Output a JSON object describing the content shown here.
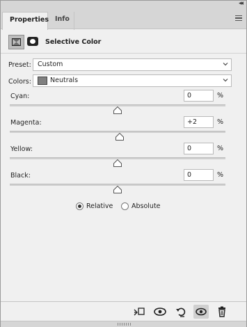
{
  "panel": {
    "collapse_glyph": "◂◂",
    "tabs": [
      {
        "label": "Properties",
        "active": true
      },
      {
        "label": "Info",
        "active": false
      }
    ],
    "menu_icon": "panel-menu-icon"
  },
  "header": {
    "title": "Selective Color",
    "adjustment_icon": "selective-color-adjustment-icon",
    "mask_icon": "layer-mask-icon"
  },
  "preset": {
    "label": "Preset:",
    "value": "Custom"
  },
  "colors": {
    "label": "Colors:",
    "value": "Neutrals",
    "swatch_color": "#808080"
  },
  "sliders": [
    {
      "label": "Cyan:",
      "value": "0",
      "unit": "%",
      "level": 0
    },
    {
      "label": "Magenta:",
      "value": "+2",
      "unit": "%",
      "level": 2
    },
    {
      "label": "Yellow:",
      "value": "0",
      "unit": "%",
      "level": 0
    },
    {
      "label": "Black:",
      "value": "0",
      "unit": "%",
      "level": 0
    }
  ],
  "method": {
    "options": [
      {
        "label": "Relative",
        "checked": true
      },
      {
        "label": "Absolute",
        "checked": false
      }
    ]
  },
  "toolbar": {
    "buttons": [
      {
        "icon": "clip-to-layer-icon"
      },
      {
        "icon": "view-previous-state-icon"
      },
      {
        "icon": "reset-adjustment-icon"
      },
      {
        "icon": "toggle-visibility-icon",
        "active": true
      },
      {
        "icon": "delete-adjustment-icon"
      }
    ]
  }
}
